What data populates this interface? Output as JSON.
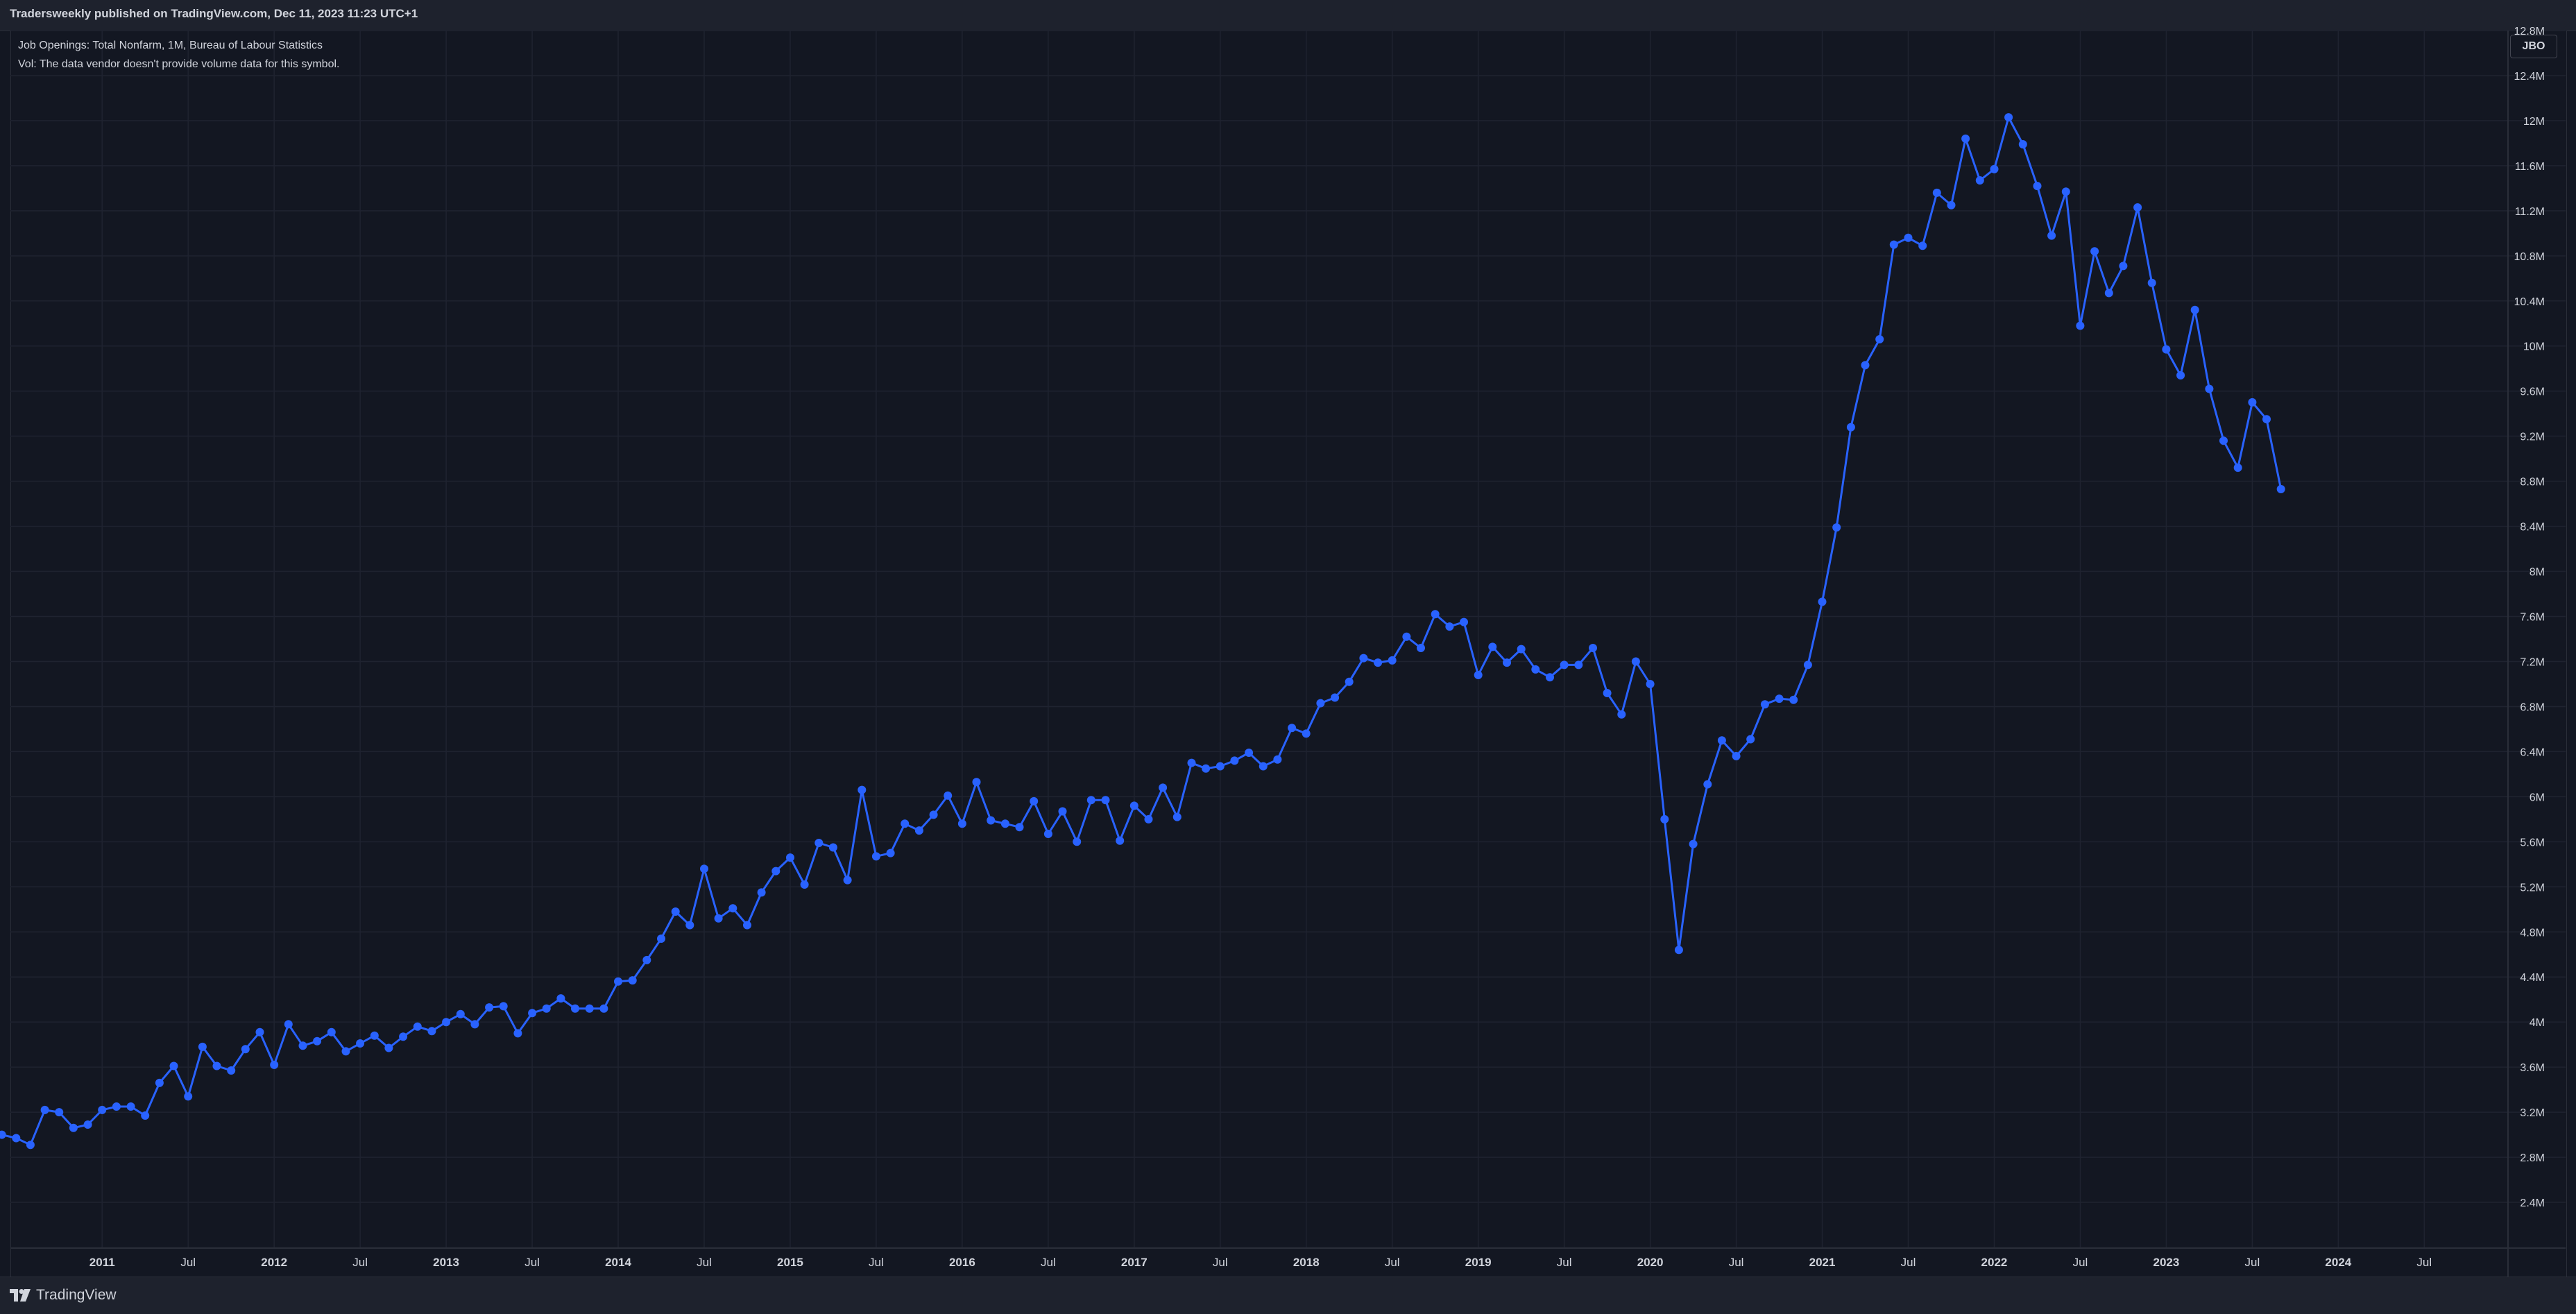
{
  "header": {
    "publish_line": "Tradersweekly published on TradingView.com, Dec 11, 2023 11:23 UTC+1"
  },
  "legend": {
    "line1": "Job Openings: Total Nonfarm, 1M, Bureau of Labour Statistics",
    "line2": "Vol: The data vendor doesn't provide volume data for this symbol."
  },
  "symbol_badge": "JBO",
  "footer": {
    "logo_text": "TradingView",
    "logo_icon": "tradingview-logo-icon"
  },
  "colors": {
    "background": "#131722",
    "series": "#2962ff",
    "grid": "#1f2330",
    "text": "#d1d4dc"
  },
  "chart_data": {
    "type": "line",
    "x_axis_labels": [
      {
        "date": "2011-01",
        "label": "2011",
        "bold": true
      },
      {
        "date": "2011-07",
        "label": "Jul",
        "bold": false
      },
      {
        "date": "2012-01",
        "label": "2012",
        "bold": true
      },
      {
        "date": "2012-07",
        "label": "Jul",
        "bold": false
      },
      {
        "date": "2013-01",
        "label": "2013",
        "bold": true
      },
      {
        "date": "2013-07",
        "label": "Jul",
        "bold": false
      },
      {
        "date": "2014-01",
        "label": "2014",
        "bold": true
      },
      {
        "date": "2014-07",
        "label": "Jul",
        "bold": false
      },
      {
        "date": "2015-01",
        "label": "2015",
        "bold": true
      },
      {
        "date": "2015-07",
        "label": "Jul",
        "bold": false
      },
      {
        "date": "2016-01",
        "label": "2016",
        "bold": true
      },
      {
        "date": "2016-07",
        "label": "Jul",
        "bold": false
      },
      {
        "date": "2017-01",
        "label": "2017",
        "bold": true
      },
      {
        "date": "2017-07",
        "label": "Jul",
        "bold": false
      },
      {
        "date": "2018-01",
        "label": "2018",
        "bold": true
      },
      {
        "date": "2018-07",
        "label": "Jul",
        "bold": false
      },
      {
        "date": "2019-01",
        "label": "2019",
        "bold": true
      },
      {
        "date": "2019-07",
        "label": "Jul",
        "bold": false
      },
      {
        "date": "2020-01",
        "label": "2020",
        "bold": true
      },
      {
        "date": "2020-07",
        "label": "Jul",
        "bold": false
      },
      {
        "date": "2021-01",
        "label": "2021",
        "bold": true
      },
      {
        "date": "2021-07",
        "label": "Jul",
        "bold": false
      },
      {
        "date": "2022-01",
        "label": "2022",
        "bold": true
      },
      {
        "date": "2022-07",
        "label": "Jul",
        "bold": false
      },
      {
        "date": "2023-01",
        "label": "2023",
        "bold": true
      },
      {
        "date": "2023-07",
        "label": "Jul",
        "bold": false
      },
      {
        "date": "2024-01",
        "label": "2024",
        "bold": true
      },
      {
        "date": "2024-07",
        "label": "Jul",
        "bold": false
      }
    ],
    "y_axis_ticks": [
      {
        "value": 2.4,
        "label": "2.4M"
      },
      {
        "value": 2.8,
        "label": "2.8M"
      },
      {
        "value": 3.2,
        "label": "3.2M"
      },
      {
        "value": 3.6,
        "label": "3.6M"
      },
      {
        "value": 4.0,
        "label": "4M"
      },
      {
        "value": 4.4,
        "label": "4.4M"
      },
      {
        "value": 4.8,
        "label": "4.8M"
      },
      {
        "value": 5.2,
        "label": "5.2M"
      },
      {
        "value": 5.6,
        "label": "5.6M"
      },
      {
        "value": 6.0,
        "label": "6M"
      },
      {
        "value": 6.4,
        "label": "6.4M"
      },
      {
        "value": 6.8,
        "label": "6.8M"
      },
      {
        "value": 7.2,
        "label": "7.2M"
      },
      {
        "value": 7.6,
        "label": "7.6M"
      },
      {
        "value": 8.0,
        "label": "8M"
      },
      {
        "value": 8.4,
        "label": "8.4M"
      },
      {
        "value": 8.8,
        "label": "8.8M"
      },
      {
        "value": 9.2,
        "label": "9.2M"
      },
      {
        "value": 9.6,
        "label": "9.6M"
      },
      {
        "value": 10.0,
        "label": "10M"
      },
      {
        "value": 10.4,
        "label": "10.4M"
      },
      {
        "value": 10.8,
        "label": "10.8M"
      },
      {
        "value": 11.2,
        "label": "11.2M"
      },
      {
        "value": 11.6,
        "label": "11.6M"
      },
      {
        "value": 12.0,
        "label": "12M"
      },
      {
        "value": 12.4,
        "label": "12.4M"
      },
      {
        "value": 12.8,
        "label": "12.8M"
      }
    ],
    "x_range": [
      "2010-06",
      "2024-12"
    ],
    "y_range": [
      2.0,
      12.8
    ],
    "y_unit": "M",
    "grid": true,
    "series": [
      {
        "marker": "circle",
        "points": [
          [
            "2010-06",
            3.0
          ],
          [
            "2010-07",
            2.97
          ],
          [
            "2010-08",
            2.91
          ],
          [
            "2010-09",
            3.22
          ],
          [
            "2010-10",
            3.2
          ],
          [
            "2010-11",
            3.06
          ],
          [
            "2010-12",
            3.09
          ],
          [
            "2011-01",
            3.22
          ],
          [
            "2011-02",
            3.25
          ],
          [
            "2011-03",
            3.25
          ],
          [
            "2011-04",
            3.17
          ],
          [
            "2011-05",
            3.46
          ],
          [
            "2011-06",
            3.61
          ],
          [
            "2011-07",
            3.34
          ],
          [
            "2011-08",
            3.78
          ],
          [
            "2011-09",
            3.61
          ],
          [
            "2011-10",
            3.57
          ],
          [
            "2011-11",
            3.76
          ],
          [
            "2011-12",
            3.91
          ],
          [
            "2012-01",
            3.62
          ],
          [
            "2012-02",
            3.98
          ],
          [
            "2012-03",
            3.79
          ],
          [
            "2012-04",
            3.83
          ],
          [
            "2012-05",
            3.91
          ],
          [
            "2012-06",
            3.74
          ],
          [
            "2012-07",
            3.81
          ],
          [
            "2012-08",
            3.88
          ],
          [
            "2012-09",
            3.77
          ],
          [
            "2012-10",
            3.87
          ],
          [
            "2012-11",
            3.96
          ],
          [
            "2012-12",
            3.92
          ],
          [
            "2013-01",
            4.0
          ],
          [
            "2013-02",
            4.07
          ],
          [
            "2013-03",
            3.98
          ],
          [
            "2013-04",
            4.13
          ],
          [
            "2013-05",
            4.14
          ],
          [
            "2013-06",
            3.9
          ],
          [
            "2013-07",
            4.08
          ],
          [
            "2013-08",
            4.12
          ],
          [
            "2013-09",
            4.21
          ],
          [
            "2013-10",
            4.12
          ],
          [
            "2013-11",
            4.12
          ],
          [
            "2013-12",
            4.12
          ],
          [
            "2014-01",
            4.36
          ],
          [
            "2014-02",
            4.37
          ],
          [
            "2014-03",
            4.55
          ],
          [
            "2014-04",
            4.74
          ],
          [
            "2014-05",
            4.98
          ],
          [
            "2014-06",
            4.86
          ],
          [
            "2014-07",
            5.36
          ],
          [
            "2014-08",
            4.92
          ],
          [
            "2014-09",
            5.01
          ],
          [
            "2014-10",
            4.86
          ],
          [
            "2014-11",
            5.15
          ],
          [
            "2014-12",
            5.34
          ],
          [
            "2015-01",
            5.46
          ],
          [
            "2015-02",
            5.22
          ],
          [
            "2015-03",
            5.59
          ],
          [
            "2015-04",
            5.55
          ],
          [
            "2015-05",
            5.26
          ],
          [
            "2015-06",
            6.06
          ],
          [
            "2015-07",
            5.47
          ],
          [
            "2015-08",
            5.5
          ],
          [
            "2015-09",
            5.76
          ],
          [
            "2015-10",
            5.7
          ],
          [
            "2015-11",
            5.84
          ],
          [
            "2015-12",
            6.01
          ],
          [
            "2016-01",
            5.76
          ],
          [
            "2016-02",
            6.13
          ],
          [
            "2016-03",
            5.79
          ],
          [
            "2016-04",
            5.76
          ],
          [
            "2016-05",
            5.73
          ],
          [
            "2016-06",
            5.96
          ],
          [
            "2016-07",
            5.67
          ],
          [
            "2016-08",
            5.87
          ],
          [
            "2016-09",
            5.6
          ],
          [
            "2016-10",
            5.97
          ],
          [
            "2016-11",
            5.97
          ],
          [
            "2016-12",
            5.61
          ],
          [
            "2017-01",
            5.92
          ],
          [
            "2017-02",
            5.8
          ],
          [
            "2017-03",
            6.08
          ],
          [
            "2017-04",
            5.82
          ],
          [
            "2017-05",
            6.3
          ],
          [
            "2017-06",
            6.25
          ],
          [
            "2017-07",
            6.27
          ],
          [
            "2017-08",
            6.32
          ],
          [
            "2017-09",
            6.39
          ],
          [
            "2017-10",
            6.27
          ],
          [
            "2017-11",
            6.33
          ],
          [
            "2017-12",
            6.61
          ],
          [
            "2018-01",
            6.56
          ],
          [
            "2018-02",
            6.83
          ],
          [
            "2018-03",
            6.88
          ],
          [
            "2018-04",
            7.02
          ],
          [
            "2018-05",
            7.23
          ],
          [
            "2018-06",
            7.19
          ],
          [
            "2018-07",
            7.21
          ],
          [
            "2018-08",
            7.42
          ],
          [
            "2018-09",
            7.32
          ],
          [
            "2018-10",
            7.62
          ],
          [
            "2018-11",
            7.51
          ],
          [
            "2018-12",
            7.55
          ],
          [
            "2019-01",
            7.08
          ],
          [
            "2019-02",
            7.33
          ],
          [
            "2019-03",
            7.19
          ],
          [
            "2019-04",
            7.31
          ],
          [
            "2019-05",
            7.13
          ],
          [
            "2019-06",
            7.06
          ],
          [
            "2019-07",
            7.17
          ],
          [
            "2019-08",
            7.17
          ],
          [
            "2019-09",
            7.32
          ],
          [
            "2019-10",
            6.92
          ],
          [
            "2019-11",
            6.73
          ],
          [
            "2019-12",
            7.2
          ],
          [
            "2020-01",
            7.0
          ],
          [
            "2020-02",
            5.8
          ],
          [
            "2020-03",
            4.64
          ],
          [
            "2020-04",
            5.58
          ],
          [
            "2020-05",
            6.11
          ],
          [
            "2020-06",
            6.5
          ],
          [
            "2020-07",
            6.36
          ],
          [
            "2020-08",
            6.51
          ],
          [
            "2020-09",
            6.82
          ],
          [
            "2020-10",
            6.87
          ],
          [
            "2020-11",
            6.86
          ],
          [
            "2020-12",
            7.17
          ],
          [
            "2021-01",
            7.73
          ],
          [
            "2021-02",
            8.39
          ],
          [
            "2021-03",
            9.28
          ],
          [
            "2021-04",
            9.83
          ],
          [
            "2021-05",
            10.06
          ],
          [
            "2021-06",
            10.9
          ],
          [
            "2021-07",
            10.96
          ],
          [
            "2021-08",
            10.89
          ],
          [
            "2021-09",
            11.36
          ],
          [
            "2021-10",
            11.25
          ],
          [
            "2021-11",
            11.84
          ],
          [
            "2021-12",
            11.47
          ],
          [
            "2022-01",
            11.57
          ],
          [
            "2022-02",
            12.03
          ],
          [
            "2022-03",
            11.79
          ],
          [
            "2022-04",
            11.42
          ],
          [
            "2022-05",
            10.98
          ],
          [
            "2022-06",
            11.37
          ],
          [
            "2022-07",
            10.18
          ],
          [
            "2022-08",
            10.84
          ],
          [
            "2022-09",
            10.47
          ],
          [
            "2022-10",
            10.71
          ],
          [
            "2022-11",
            11.23
          ],
          [
            "2022-12",
            10.56
          ],
          [
            "2023-01",
            9.97
          ],
          [
            "2023-02",
            9.74
          ],
          [
            "2023-03",
            10.32
          ],
          [
            "2023-04",
            9.62
          ],
          [
            "2023-05",
            9.16
          ],
          [
            "2023-06",
            8.92
          ],
          [
            "2023-07",
            9.5
          ],
          [
            "2023-08",
            9.35
          ],
          [
            "2023-09",
            8.73
          ]
        ]
      }
    ]
  }
}
